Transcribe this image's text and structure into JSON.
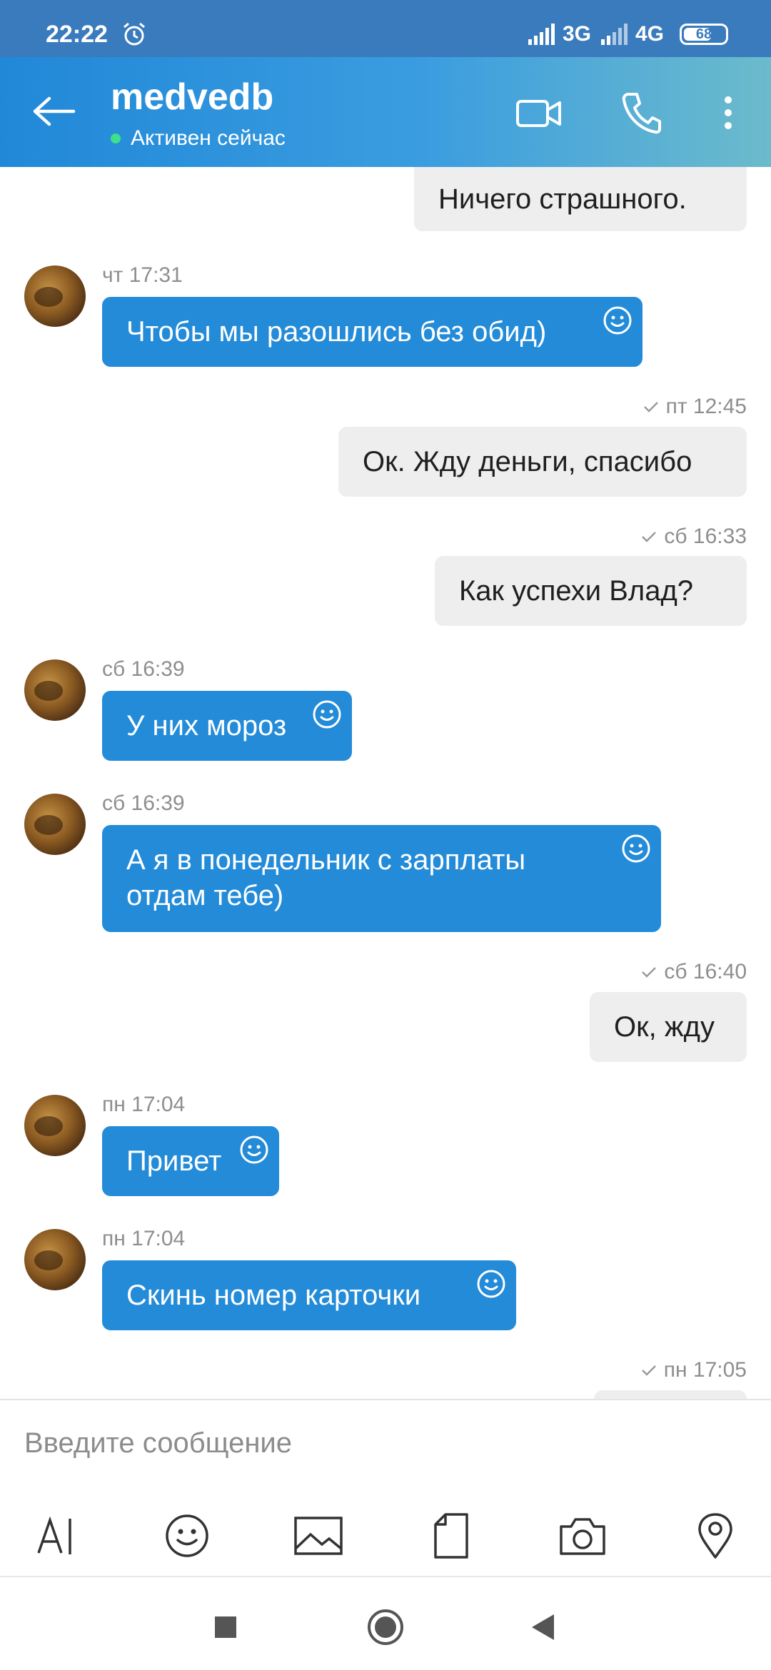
{
  "status_bar": {
    "time": "22:22",
    "net1": "3G",
    "net2": "4G",
    "battery": "68",
    "battery_level": 0.68
  },
  "header": {
    "title": "medvedb",
    "presence": "Активен сейчас",
    "icons": [
      "back-arrow-icon",
      "video-call-icon",
      "phone-icon",
      "more-vertical-icon"
    ]
  },
  "messages": [
    {
      "direction": "out",
      "text": "Ничего страшного.",
      "time": ""
    },
    {
      "direction": "in",
      "text": "Чтобы мы разошлись без обид)",
      "time": "чт 17:31"
    },
    {
      "direction": "out",
      "text": "Ок. Жду деньги, спасибо",
      "time": "пт 12:45"
    },
    {
      "direction": "out",
      "text": "Как успехи Влад?",
      "time": "сб 16:33"
    },
    {
      "direction": "in",
      "text": "У них мороз",
      "time": "сб 16:39"
    },
    {
      "direction": "in",
      "text": "А я в понедельник с зарплаты отдам тебе)",
      "time": "сб 16:39"
    },
    {
      "direction": "out",
      "text": "Ок, жду",
      "time": "сб 16:40"
    },
    {
      "direction": "in",
      "text": "Привет",
      "time": "пн 17:04"
    },
    {
      "direction": "in",
      "text": "Скинь номер карточки",
      "time": "пн 17:04"
    },
    {
      "direction": "out",
      "text": "",
      "time": "пн 17:05"
    }
  ],
  "composer": {
    "placeholder": "Введите сообщение",
    "tools": [
      "text-format-icon",
      "emoji-icon",
      "image-icon",
      "file-icon",
      "camera-icon",
      "location-icon"
    ]
  },
  "colors": {
    "incoming_bubble": "#238bd8",
    "outgoing_bubble": "#eeeeef",
    "header_start": "#2188d8",
    "header_end": "#6cbbcc",
    "status_bar": "#3a7bbd",
    "presence_dot": "#3ee089"
  }
}
